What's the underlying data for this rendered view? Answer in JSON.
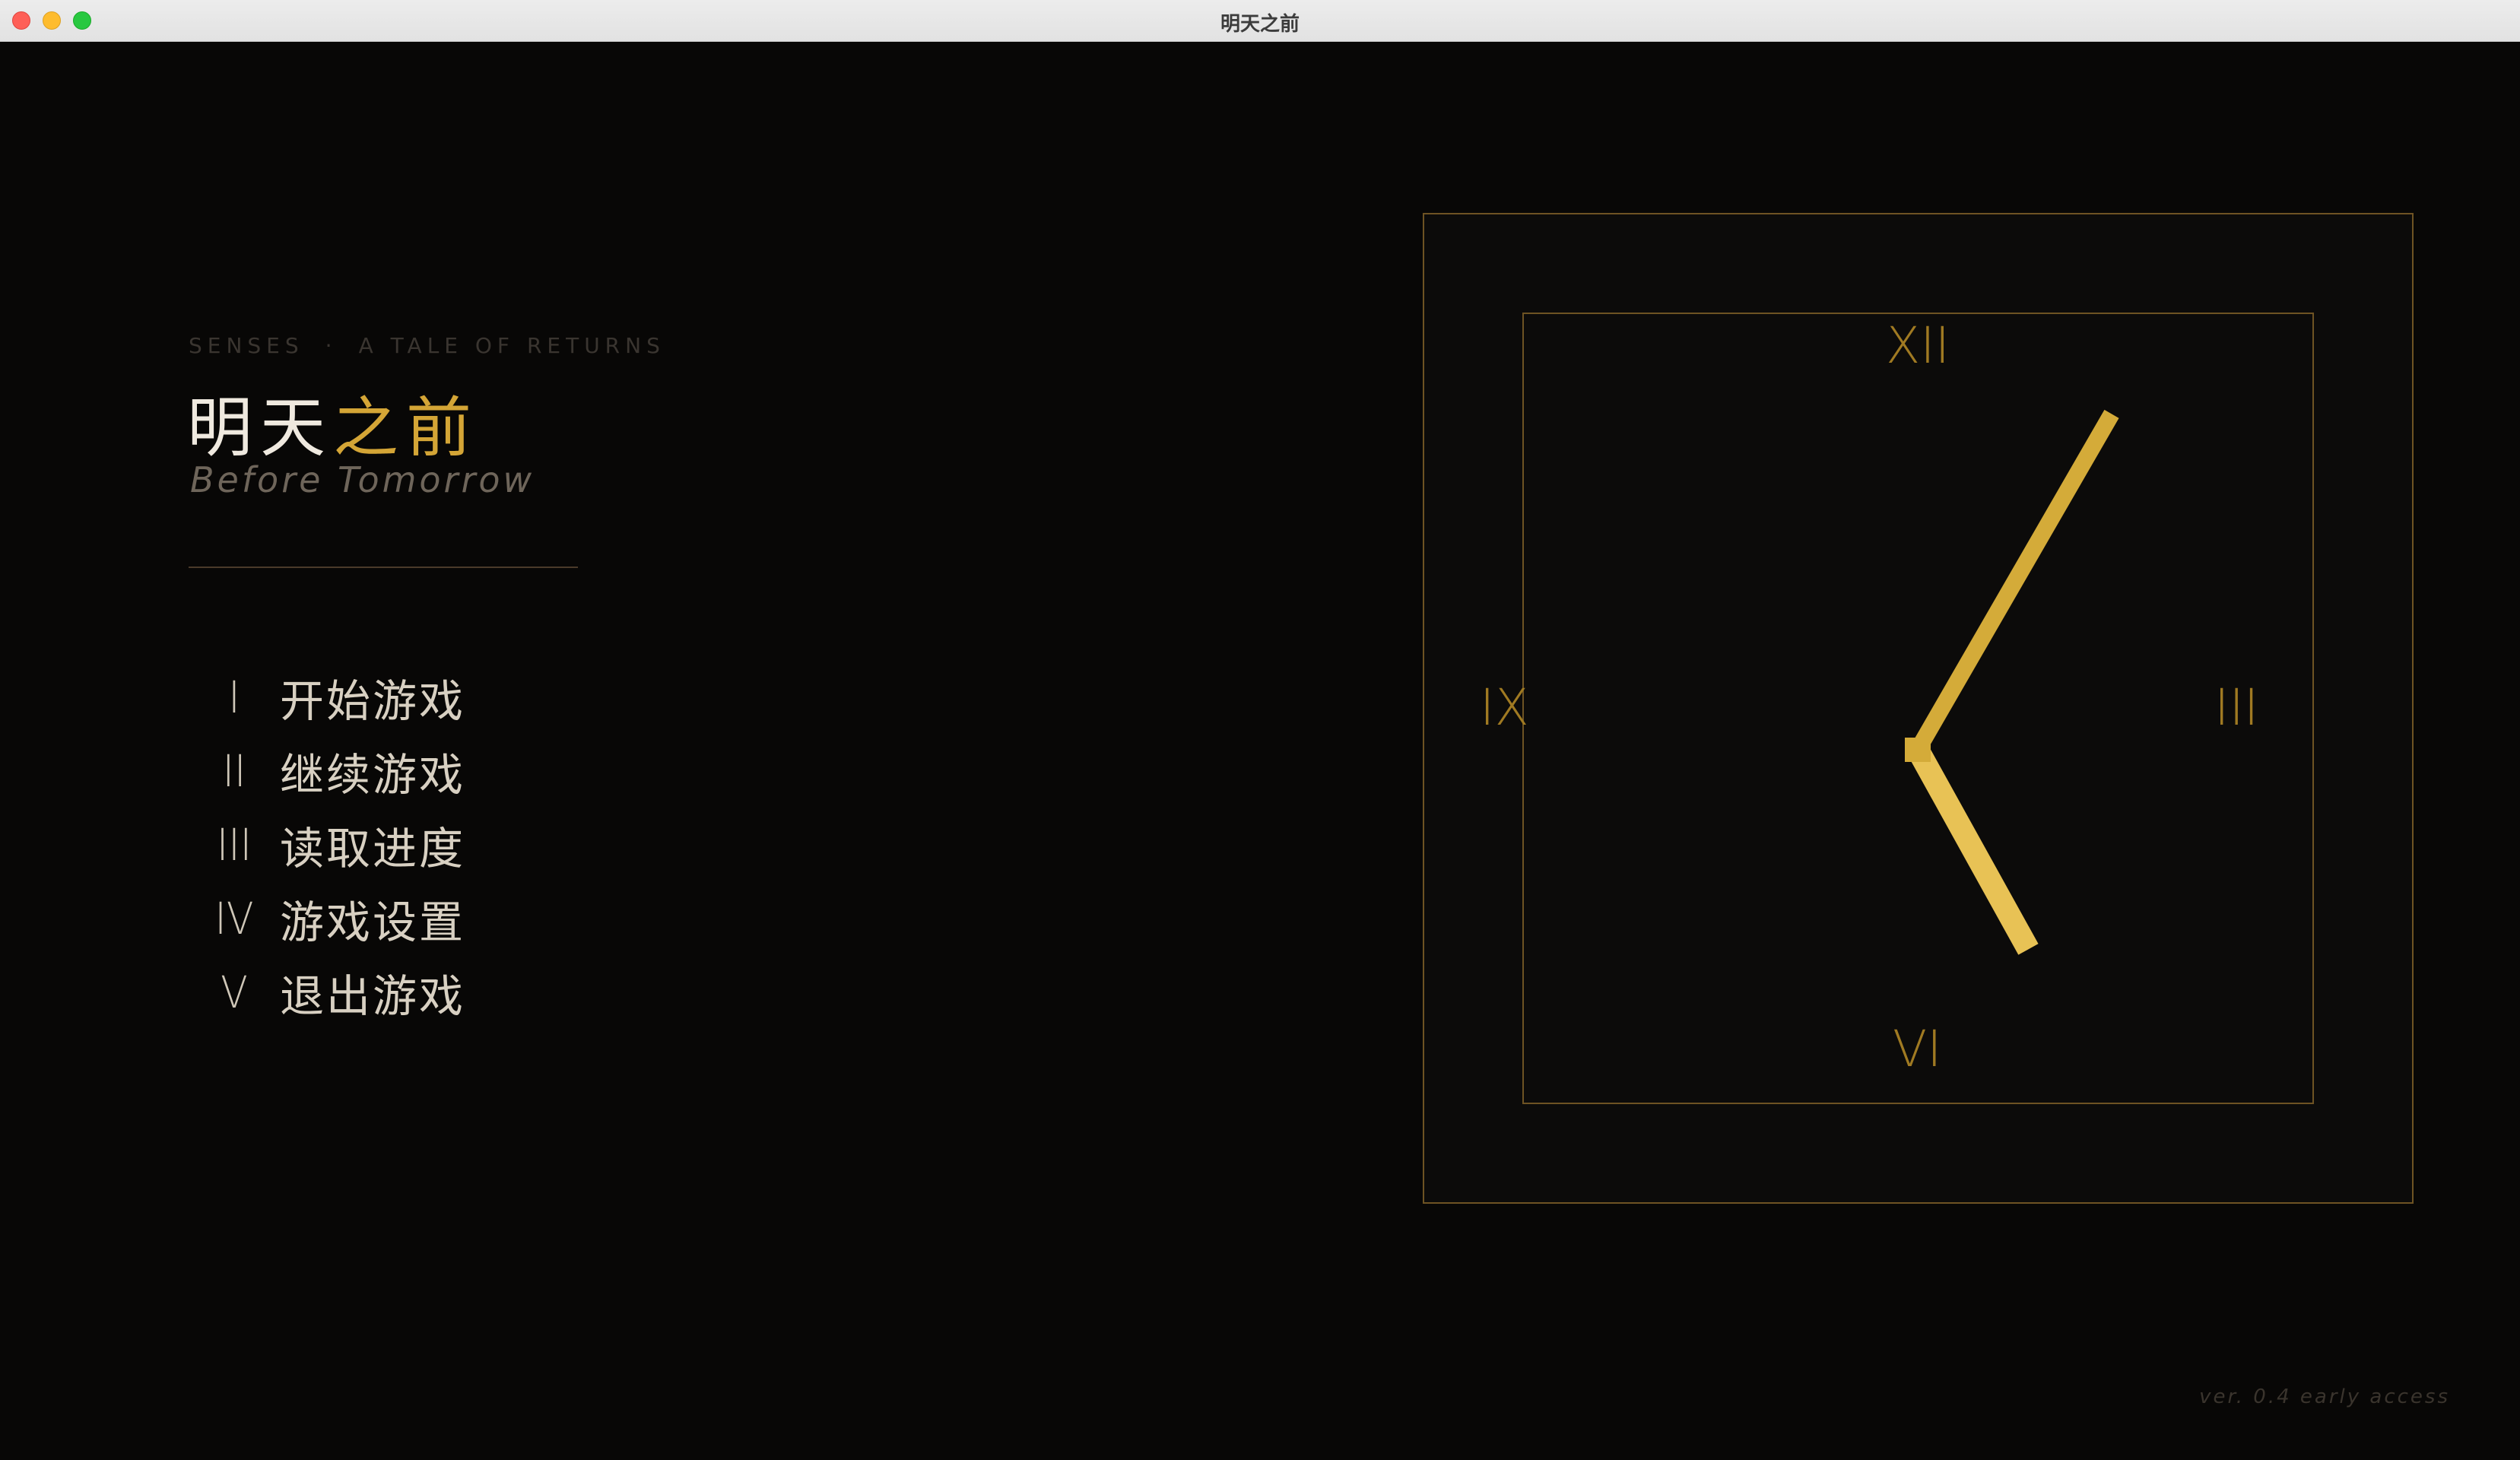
{
  "window": {
    "title": "明天之前"
  },
  "header": {
    "tagline_left": "SENSES",
    "tagline_sep": "·",
    "tagline_right": "A TALE OF RETURNS",
    "title_plain": "明天",
    "title_accent": "之前",
    "subtitle": "Before Tomorrow"
  },
  "menu": {
    "items": [
      {
        "numeral": "I",
        "label": "开始游戏"
      },
      {
        "numeral": "II",
        "label": "继续游戏"
      },
      {
        "numeral": "III",
        "label": "读取进度"
      },
      {
        "numeral": "IV",
        "label": "游戏设置"
      },
      {
        "numeral": "V",
        "label": "退出游戏"
      }
    ]
  },
  "clock": {
    "numerals": {
      "twelve": "XII",
      "three": "III",
      "six": "VI",
      "nine": "IX"
    },
    "hour_angle_deg": 151,
    "minute_angle_deg": 30,
    "hand_color": "#d4ab39",
    "frame_color": "#6e5323"
  },
  "footer": {
    "version": "ver. 0.4  early access"
  },
  "colors": {
    "background": "#080706",
    "accent": "#d4a536",
    "menu_text": "#d8d0c2"
  }
}
